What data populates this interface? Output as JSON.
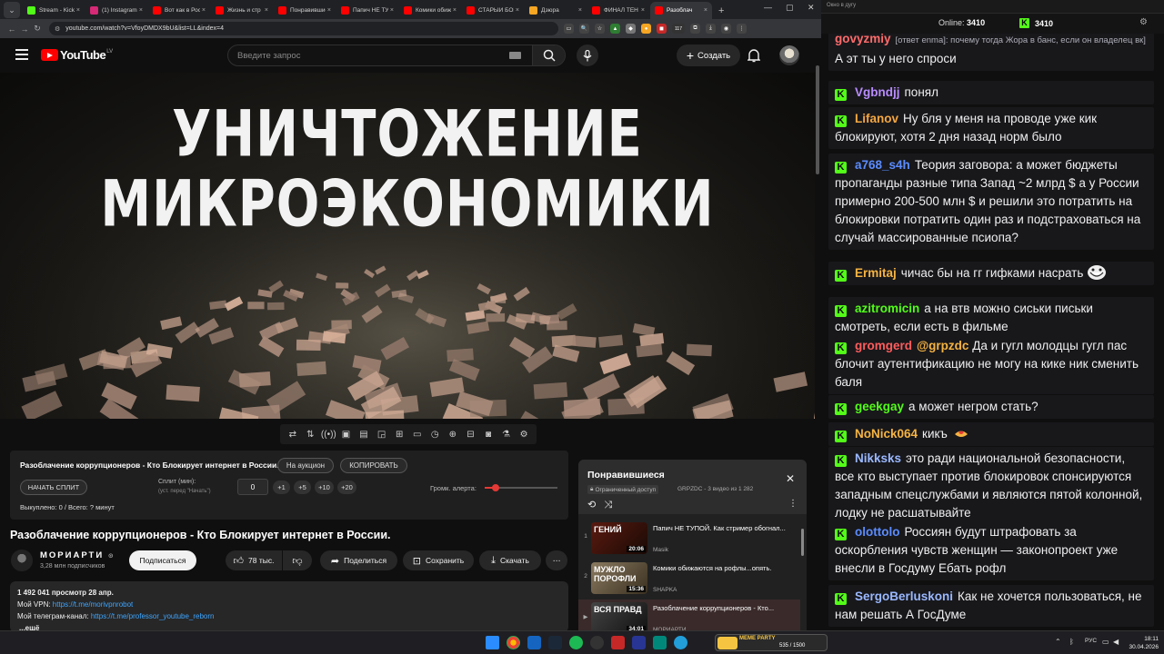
{
  "browser": {
    "tabs": [
      {
        "label": "Stream - Kick",
        "color": "#53fc18"
      },
      {
        "label": "(1) Instagram",
        "color": "#d62976"
      },
      {
        "label": "Вот как в Росс",
        "color": "#ff0000"
      },
      {
        "label": "Жизнь и стр",
        "color": "#ff0000"
      },
      {
        "label": "Понравившие",
        "color": "#ff0000"
      },
      {
        "label": "Папич НЕ ТУП",
        "color": "#ff0000"
      },
      {
        "label": "Комики обижа",
        "color": "#ff0000"
      },
      {
        "label": "СТАРЫЙ БОГ",
        "color": "#ff0000"
      },
      {
        "label": "Дзюра",
        "color": "#f5a623"
      },
      {
        "label": "ФИНАЛ ТЕН",
        "color": "#ff0000"
      },
      {
        "label": "Разоблач",
        "color": "#ff0000"
      }
    ],
    "active_tab": 10,
    "url": "youtube.com/watch?v=VfoyDMDX9bU&list=LL&index=4",
    "ext_badge": "117"
  },
  "youtube": {
    "logo_text": "YouTube",
    "region": "LV",
    "search_placeholder": "Введите запрос",
    "create_label": "Создать"
  },
  "video": {
    "thumb_line1": "УНИЧТОЖЕНИЕ",
    "thumb_line2": "МИКРОЭКОНОМИКИ",
    "title": "Разоблачение коррупционеров - Кто Блокирует интернет в России.",
    "channel": "МОРИАРТИ",
    "subscribers": "3,28 млн подписчиков",
    "subscribe_label": "Подписаться",
    "likes": "78 тыс.",
    "share_label": "Поделиться",
    "save_label": "Сохранить",
    "download_label": "Скачать",
    "desc_line1": "1 492 041 просмотр  28 апр.",
    "desc_vpn_label": "Мой VPN: ",
    "desc_vpn_link": "https://t.me/morivpnrobot",
    "desc_tg_label": "Мой телеграм-канал: ",
    "desc_tg_link": "https://t.me/professor_youtube_reborn",
    "desc_more": "...ещё"
  },
  "ext_panel": {
    "title": "Разоблачение коррупционеров - Кто Блокирует интернет в России.",
    "auction_label": "На аукцион",
    "copy_label": "КОПИРОВАТЬ",
    "start_split_label": "НАЧАТЬ СПЛИТ",
    "split_label": "Сплит (мин):",
    "split_hint": "(уст. перед \"Начать\")",
    "split_value": "0",
    "btn_p1": "+1",
    "btn_p5": "+5",
    "btn_p10": "+10",
    "btn_p20": "+20",
    "volume_label": "Громк. алерта:",
    "volume_fraction": 0.15,
    "paid_text": "Выкуплено: 0 / Всего: ? минут"
  },
  "playlist": {
    "title": "Понравившиеся",
    "access": "Ограниченный доступ",
    "meta": "GRPZDC - 3 видео из 1 282",
    "items": [
      {
        "index": "1",
        "thumb_text": "ГЕНИЙ",
        "duration": "20:06",
        "title": "Папич НЕ ТУПОЙ. Как стример обогнал...",
        "channel": "Masik"
      },
      {
        "index": "2",
        "thumb_text": "МУЖЛО ПОРОФЛИ",
        "duration": "15:36",
        "title": "Комики обижаются на рофлы...опять.",
        "channel": "SHAPKA"
      },
      {
        "index": "▶",
        "thumb_text": "ВСЯ ПРАВД",
        "duration": "34:01",
        "title": "Разоблачение коррупционеров - Кто...",
        "channel": "МОРИАРТИ"
      }
    ]
  },
  "chat": {
    "window_title": "Окно в дугу",
    "online_label": "Online:",
    "online_count": "3410",
    "kick_count": "3410",
    "messages": [
      {
        "user": "govyzmiy",
        "color": "#ff6b6b",
        "reply": "[ответ enma]: почему тогда Жора в банс, если он владелец вк]",
        "text": "А эт ты у него спроси",
        "badge": false
      },
      {
        "user": "Vgbndjj",
        "color": "#b98cff",
        "text": "понял",
        "badge": true
      },
      {
        "user": "Lifanov",
        "color": "#f5a742",
        "text": "Ну бля у меня на проводе уже кик блокируют, хотя 2 дня назад норм было",
        "badge": true
      },
      {
        "user": "a768_s4h",
        "color": "#5b8cff",
        "text": "Теория заговора: а может бюджеты пропаганды разные типа Запад ~2 млрд $ а у России примерно 200-500 млн $ и решили это потратить на блокировки потратить один раз и подстраховаться на случай массированные псиопа?",
        "badge": true
      },
      {
        "user": "Ermitaj",
        "color": "#f5b342",
        "text": "чичас бы на гг гифками насрать",
        "badge": true
      },
      {
        "user": "azitromicin",
        "color": "#53fc18",
        "text": "а на втв можно сиськи письки смотреть, если есть в фильме",
        "badge": true
      },
      {
        "user": "gromgerd",
        "color": "#ff5c5c",
        "mention": "@grpzdc",
        "text": "Да и гугл молодцы гугл пас блочит аутентификацию не могу на кике ник сменить баля",
        "badge": true
      },
      {
        "user": "geekgay",
        "color": "#53fc18",
        "text": "а может негром стать?",
        "badge": true
      },
      {
        "user": "NoNick064",
        "color": "#f5b342",
        "text": "кикъ",
        "badge": true
      },
      {
        "user": "Nikksks",
        "color": "#9ab8ff",
        "text": "это ради национальной безопасности, все кто выступает против блокировок спонсируются западным спецслужбами и являются пятой колонной, лодку не расшатывайте",
        "badge": true
      },
      {
        "user": "olottolo",
        "color": "#5b8cff",
        "text": "Россиян будут штрафовать за оскорбления чувств женщин — законопроект уже внесли в Госдуму Ебать рофл",
        "badge": true
      },
      {
        "user": "SergoBerluskoni",
        "color": "#9ab8ff",
        "text": "Как не хочется пользоваться, не нам решать А ГосДуме",
        "badge": true
      }
    ]
  },
  "taskbar": {
    "lang": "РУС",
    "time": "18:11",
    "date": "30.04.2026",
    "widget_title": "MEME PARTY",
    "widget_progress": "535 / 1500"
  }
}
